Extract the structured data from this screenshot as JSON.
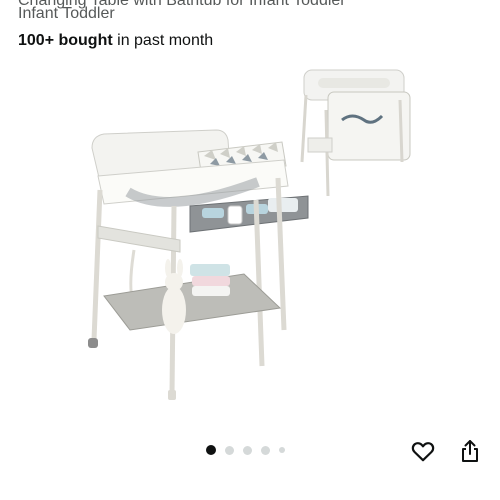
{
  "product": {
    "title_partial_top": "Changing Table with Bathtub for Infant Toddler",
    "title_line2": "Infant Toddler",
    "social_proof_bold": "100+ bought",
    "social_proof_rest": " in past month"
  },
  "gallery": {
    "image_count": 5,
    "active_index": 0
  },
  "actions": {
    "wishlist_icon": "heart-icon",
    "share_icon": "share-icon"
  }
}
